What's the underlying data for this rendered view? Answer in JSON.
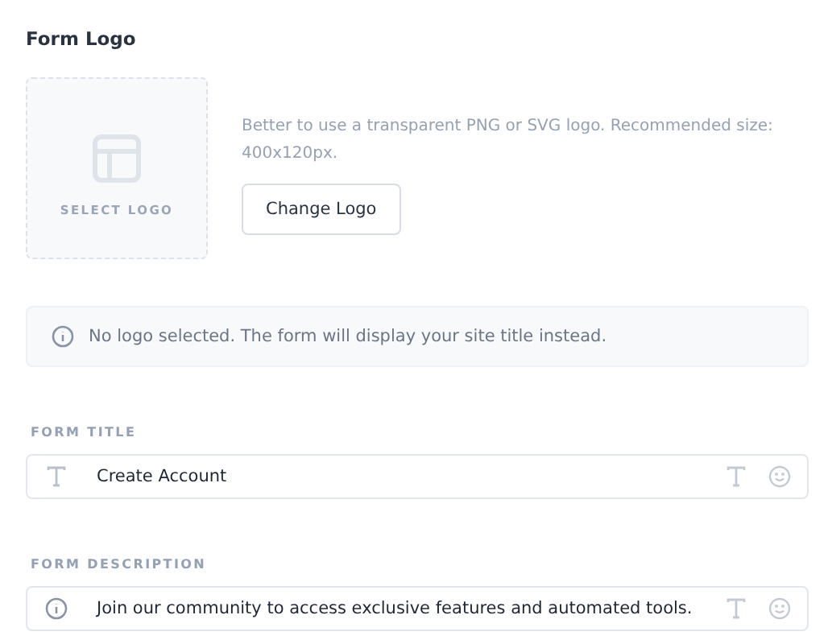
{
  "section_title": "Form Logo",
  "logo_picker": {
    "label": "SELECT LOGO"
  },
  "hint": "Better to use a transparent PNG or SVG logo. Recommended size: 400x120px.",
  "change_button": "Change Logo",
  "notice": "No logo selected. The form will display your site title instead.",
  "fields": [
    {
      "label": "FORM TITLE",
      "kind": "text",
      "value": "Create Account"
    },
    {
      "label": "FORM DESCRIPTION",
      "kind": "info",
      "value": "Join our community to access exclusive features and automated tools."
    }
  ]
}
